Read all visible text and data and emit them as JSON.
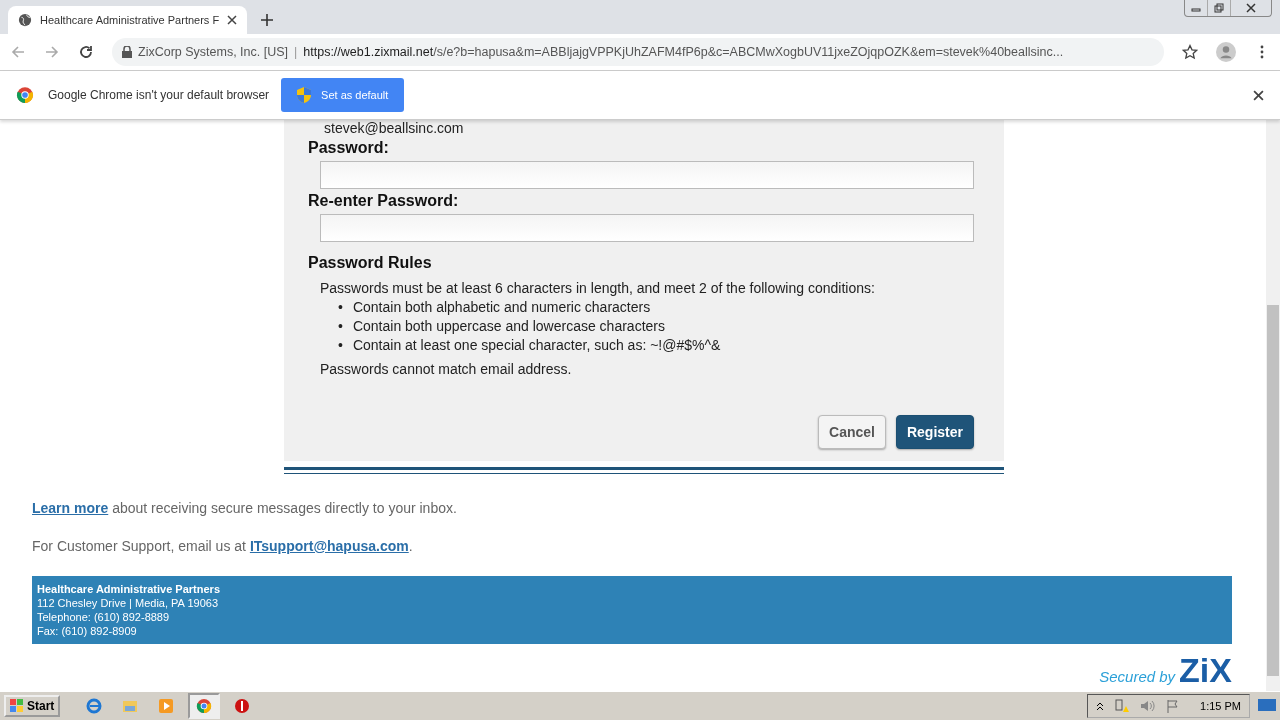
{
  "browser": {
    "tab": {
      "title": "Healthcare Administrative Partners F",
      "selected": true
    },
    "address": {
      "site": "ZixCorp Systems, Inc. [US]",
      "separator": "|",
      "url_host": "https://web1.zixmail.net",
      "url_rest": "/s/e?b=hapusa&m=ABBljajgVPPKjUhZAFM4fP6p&c=ABCMwXogbUV11jxeZOjqpOZK&em=stevek%40beallsinc..."
    },
    "infobar": {
      "message": "Google Chrome isn't your default browser",
      "button": "Set as default"
    }
  },
  "form": {
    "email": "stevek@beallsinc.com",
    "fields": [
      {
        "label": "Password:"
      },
      {
        "label": "Re-enter Password:"
      }
    ],
    "rules_title": "Password Rules",
    "rules_intro": "Passwords must be at least 6 characters in length, and meet 2 of the following conditions:",
    "rules": [
      {
        "marker": "•",
        "text": "Contain both alphabetic and numeric characters"
      },
      {
        "marker": "•",
        "text": "Contain both uppercase and lowercase characters"
      },
      {
        "marker": "•",
        "text": "Contain at least one special character, such as: ~!@#$%^&"
      }
    ],
    "rules_note": "Passwords cannot match email address.",
    "buttons": [
      {
        "label": "Cancel",
        "kind": "secondary"
      },
      {
        "label": "Register",
        "kind": "primary"
      }
    ]
  },
  "info": {
    "learn_link": "Learn more",
    "learn_text": " about receiving secure messages directly to your inbox.",
    "support_text": "For Customer Support, email us at ",
    "support_link": "ITsupport@hapusa.com",
    "support_end": "."
  },
  "footer": {
    "name": "Healthcare Administrative Partners",
    "lines": [
      "112 Chesley Drive | Media, PA 19063",
      "Telephone: (610) 892-8889",
      "Fax: (610) 892-8909"
    ]
  },
  "badge": {
    "prefix": "Secured by",
    "brand": "ZiX"
  },
  "taskbar": {
    "start": "Start",
    "apps": [
      {
        "kind": "ie",
        "selected": false
      },
      {
        "kind": "folder",
        "selected": false
      },
      {
        "kind": "media",
        "selected": false
      },
      {
        "kind": "chrome",
        "selected": true
      },
      {
        "kind": "stop",
        "selected": false
      }
    ],
    "clock": "1:15 PM"
  }
}
